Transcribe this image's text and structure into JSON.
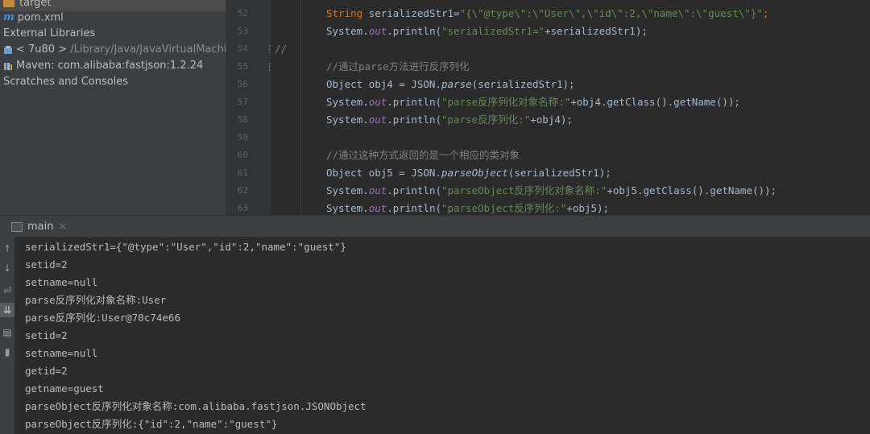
{
  "project_tree": [
    {
      "icon": "folder-icon",
      "label": "target",
      "suffix": ""
    },
    {
      "icon": "maven-m-icon",
      "label": "pom.xml",
      "suffix": ""
    },
    {
      "icon": "",
      "label": "External Libraries",
      "suffix": ""
    },
    {
      "icon": "jdk-library-icon",
      "label": "< 7u80 >",
      "suffix": " /Library/Java/JavaVirtualMachin"
    },
    {
      "icon": "maven-library-icon",
      "label": "Maven: com.alibaba:fastjson:1.2.24",
      "suffix": ""
    },
    {
      "icon": "",
      "label": "Scratches and Consoles",
      "suffix": ""
    }
  ],
  "editor": {
    "line_numbers": [
      "52",
      "53",
      "54",
      "55",
      "56",
      "57",
      "58",
      "59",
      "60",
      "61",
      "62",
      "63"
    ],
    "lines": {
      "l52": {
        "kw": "String",
        "rest": " serializedStr1=",
        "str": "\"{\\\"@type\\\":\\\"User\\\",\\\"id\\\":2,\\\"name\\\":\\\"guest\\\"}\"",
        "end": ";"
      },
      "l53": {
        "pre": "System.",
        "it": "out",
        "mid": ".println(",
        "str": "\"serializedStr1=\"",
        "end": "+serializedStr1);"
      },
      "l54": {
        "text": "//"
      },
      "l55": {
        "text": "//通过parse方法进行反序列化"
      },
      "l56": {
        "pre": "Object obj4 = JSON.",
        "mit": "parse",
        "end": "(serializedStr1);"
      },
      "l57": {
        "pre": "System.",
        "it": "out",
        "mid": ".println(",
        "str": "\"parse反序列化对象名称:\"",
        "end": "+obj4.getClass().getName());"
      },
      "l58": {
        "pre": "System.",
        "it": "out",
        "mid": ".println(",
        "str": "\"parse反序列化:\"",
        "end": "+obj4);"
      },
      "l60": {
        "text": "//通过这种方式返回的是一个相应的类对象"
      },
      "l61": {
        "pre": "Object obj5 = JSON.",
        "mit": "parseObject",
        "end": "(serializedStr1);"
      },
      "l62": {
        "pre": "System.",
        "it": "out",
        "mid": ".println(",
        "str": "\"parseObject反序列化对象名称:\"",
        "end": "+obj5.getClass().getName());"
      },
      "l63": {
        "pre": "System.",
        "it": "out",
        "mid": ".println(",
        "str": "\"parseObject反序列化:\"",
        "end": "+obj5);"
      }
    }
  },
  "run": {
    "tab_label": "main",
    "close": "×",
    "output": [
      "serializedStr1={\"@type\":\"User\",\"id\":2,\"name\":\"guest\"}",
      "setid=2",
      "setname=null",
      "parse反序列化对象名称:User",
      "parse反序列化:User@70c74e66",
      "setid=2",
      "setname=null",
      "getid=2",
      "getname=guest",
      "parseObject反序列化对象名称:com.alibaba.fastjson.JSONObject",
      "parseObject反序列化:{\"id\":2,\"name\":\"guest\"}"
    ]
  },
  "toolbar_icons": [
    "up-arrow-icon",
    "down-arrow-icon",
    "soft-wrap-icon",
    "scroll-to-end-icon",
    "print-icon",
    "trash-icon"
  ],
  "colors": {
    "keyword": "#cc7832",
    "string": "#6a8759",
    "comment": "#808080",
    "field": "#9876aa",
    "background": "#2b2b2b"
  }
}
